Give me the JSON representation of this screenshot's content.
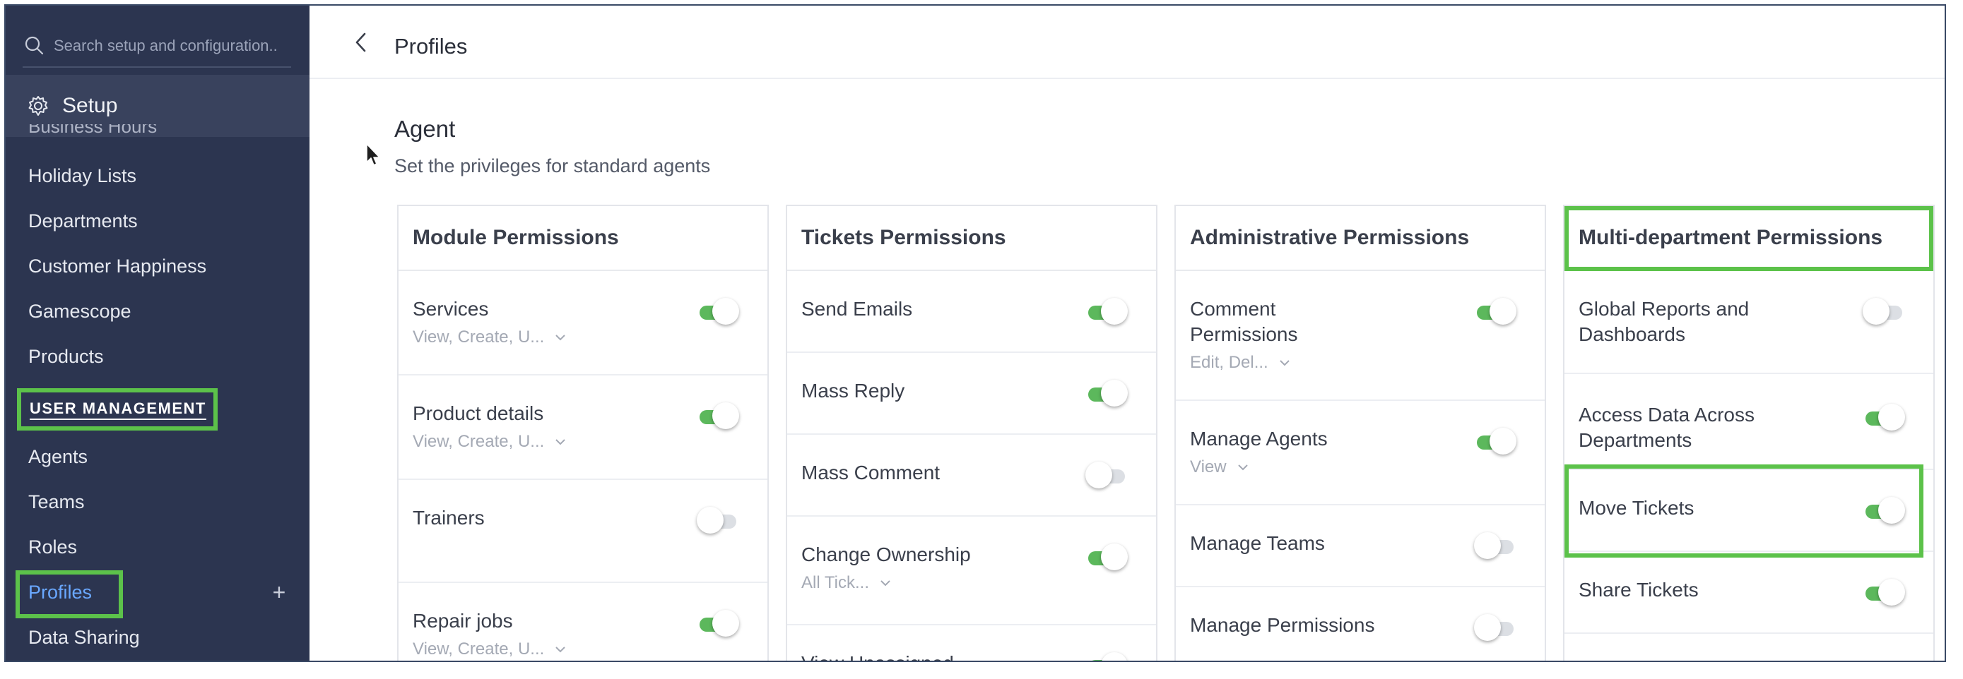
{
  "sidebar": {
    "search_placeholder": "Search setup and configuration..",
    "setup_label": "Setup",
    "cut_item": "Business Hours",
    "items_top": [
      "Holiday Lists",
      "Departments",
      "Customer Happiness",
      "Gamescope",
      "Products"
    ],
    "section_title": "USER MANAGEMENT",
    "items_bottom": [
      "Agents",
      "Teams",
      "Roles",
      "Profiles",
      "Data Sharing"
    ],
    "active_item": "Profiles",
    "add_symbol": "+"
  },
  "header": {
    "title": "Profiles"
  },
  "profile": {
    "name": "Agent",
    "description": "Set the privileges for standard agents"
  },
  "colors": {
    "sidebar_bg": "#2c3550",
    "toggle_on": "#5cb85c",
    "highlight": "#5cc24a",
    "active_link": "#6aa8ff"
  },
  "panels": [
    {
      "title": "Module Permissions",
      "rows": [
        {
          "label": "Services",
          "sub": "View, Create, U...",
          "on": true
        },
        {
          "label": "Product details",
          "sub": "View, Create, U...",
          "on": true
        },
        {
          "label": "Trainers",
          "sub": "",
          "on": false
        },
        {
          "label": "Repair jobs",
          "sub": "View, Create, U...",
          "on": true
        }
      ]
    },
    {
      "title": "Tickets Permissions",
      "rows": [
        {
          "label": "Send Emails",
          "sub": "",
          "on": true
        },
        {
          "label": "Mass Reply",
          "sub": "",
          "on": true
        },
        {
          "label": "Mass Comment",
          "sub": "",
          "on": false
        },
        {
          "label": "Change Ownership",
          "sub": "All Tick...",
          "on": true
        },
        {
          "label": "View Unassigned",
          "sub": "",
          "on": true
        }
      ]
    },
    {
      "title": "Administrative Permissions",
      "rows": [
        {
          "label": "Comment Permissions",
          "sub": "Edit, Del...",
          "on": true
        },
        {
          "label": "Manage Agents",
          "sub": "View",
          "on": true
        },
        {
          "label": "Manage Teams",
          "sub": "",
          "on": false
        },
        {
          "label": "Manage Permissions",
          "sub": "",
          "on": false
        }
      ]
    },
    {
      "title": "Multi-department Permissions",
      "rows": [
        {
          "label": "Global Reports and Dashboards",
          "sub": "",
          "on": false
        },
        {
          "label": "Access Data Across Departments",
          "sub": "",
          "on": true
        },
        {
          "label": "Move Tickets",
          "sub": "",
          "on": true
        },
        {
          "label": "Share Tickets",
          "sub": "",
          "on": true
        }
      ]
    }
  ]
}
